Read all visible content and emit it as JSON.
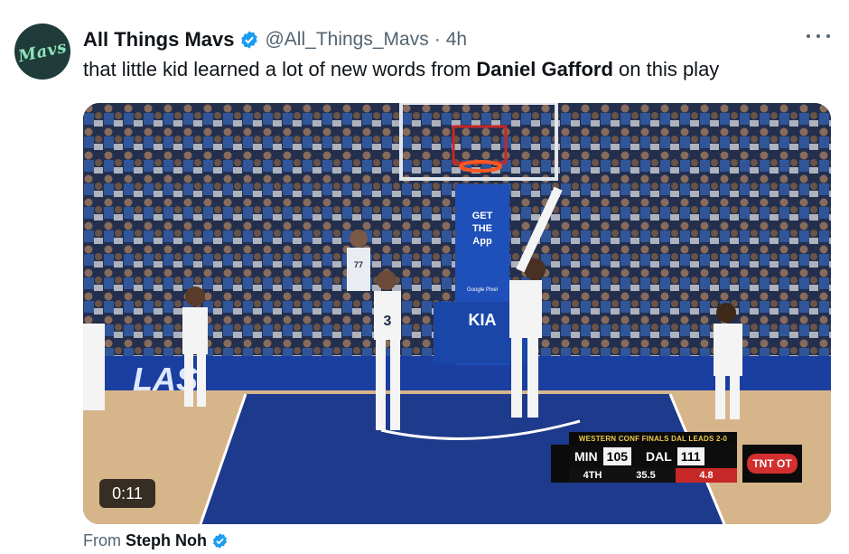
{
  "account": {
    "display_name": "All Things Mavs",
    "handle": "@All_Things_Mavs",
    "separator": "·",
    "time_ago": "4h",
    "avatar_text": "Mavs"
  },
  "tweet": {
    "text_before": "that little kid learned a lot of new words from ",
    "text_bold": "Daniel Gafford",
    "text_after": " on this play"
  },
  "video": {
    "timestamp": "0:11",
    "court_text": "LAS",
    "stanchion_text": [
      "GET",
      "THE",
      "App"
    ],
    "stanchion_sponsor": "Google Pixel",
    "stanchion_logo": "KIA",
    "jersey_numbers": [
      "3",
      "77"
    ]
  },
  "scoreboard": {
    "banner": "WESTERN CONF FINALS DAL LEADS 2-0",
    "away_team": "MIN",
    "away_score": "105",
    "home_team": "DAL",
    "home_score": "111",
    "quarter": "4TH",
    "game_clock": "35.5",
    "shot_clock": "4.8",
    "network": "TNT OT"
  },
  "footer": {
    "from_label": "From",
    "source_name": "Steph Noh"
  },
  "colors": {
    "verified_blue": "#1d9bf0",
    "muted_text": "#536471",
    "avatar_bg": "#1f3b3a",
    "avatar_fg": "#8fe3b8"
  }
}
